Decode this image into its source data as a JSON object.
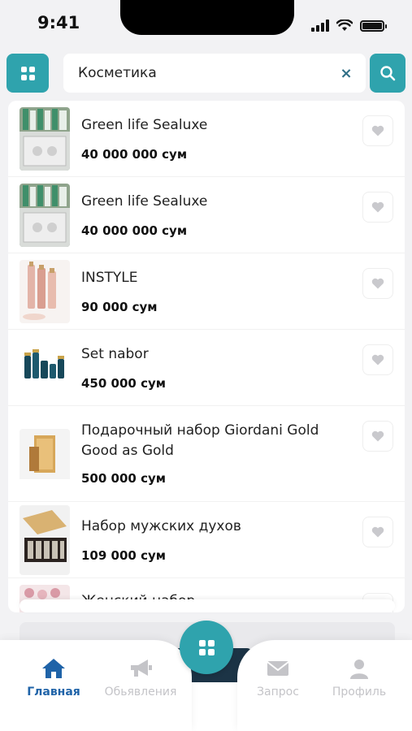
{
  "status_bar": {
    "time": "9:41"
  },
  "search": {
    "value": "Косметика",
    "clear_label": "×"
  },
  "products": [
    {
      "name": "Green life Sealuxe",
      "price": "40 000 000 сум"
    },
    {
      "name": "Green life Sealuxe",
      "price": "40 000 000 сум"
    },
    {
      "name": "INSTYLE",
      "price": "90 000 сум"
    },
    {
      "name": "Set nabor",
      "price": "450 000 сум"
    },
    {
      "name": "Подарочный набор Giordani Gold Good as Gold",
      "price": "500 000 сум"
    },
    {
      "name": "Набор мужских духов",
      "price": "109 000 сум"
    },
    {
      "name": "Женский набор",
      "price": ""
    }
  ],
  "nav": {
    "home": "Главная",
    "ads": "Обьявления",
    "requests": "Запрос",
    "profile": "Профиль"
  },
  "colors": {
    "accent": "#2fa3ad",
    "active_nav": "#1f63a8",
    "inactive_nav": "#c4c4c8"
  },
  "icons": [
    "grid-icon",
    "search-icon",
    "close-icon",
    "heart-icon",
    "home-icon",
    "megaphone-icon",
    "mail-icon",
    "user-icon",
    "signal-icon",
    "wifi-icon",
    "battery-icon"
  ]
}
